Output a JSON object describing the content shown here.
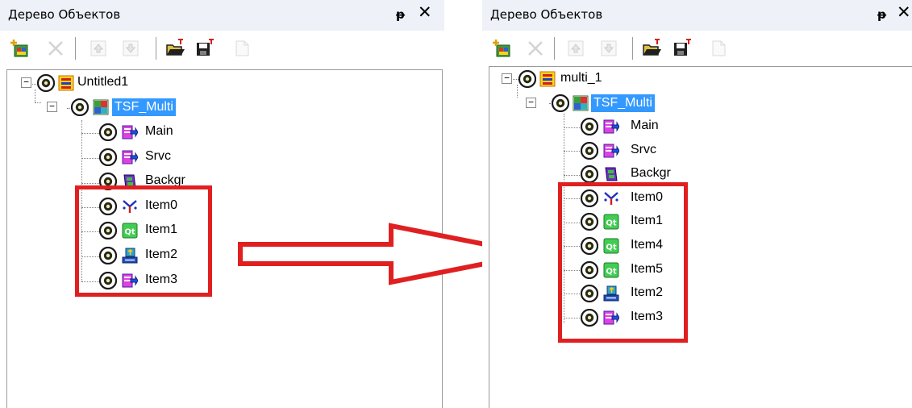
{
  "left": {
    "title": "Дерево Объектов",
    "pin": "ᵽ",
    "close": "✕",
    "root": {
      "label": "Untitled1"
    },
    "module": {
      "label": "TSF_Multi"
    },
    "items": [
      {
        "label": "Main",
        "icon": "script-arrow-icon"
      },
      {
        "label": "Srvc",
        "icon": "script-arrow-icon"
      },
      {
        "label": "Backgr",
        "icon": "film-icon"
      },
      {
        "label": "Item0",
        "icon": "cross-arrows-icon"
      },
      {
        "label": "Item1",
        "icon": "qt-icon"
      },
      {
        "label": "Item2",
        "icon": "transfer-icon"
      },
      {
        "label": "Item3",
        "icon": "script-arrow-icon"
      }
    ]
  },
  "right": {
    "title": "Дерево Объектов",
    "pin": "ᵽ",
    "close": "✕",
    "root": {
      "label": "multi_1"
    },
    "module": {
      "label": "TSF_Multi"
    },
    "items": [
      {
        "label": "Main",
        "icon": "script-arrow-icon"
      },
      {
        "label": "Srvc",
        "icon": "script-arrow-icon"
      },
      {
        "label": "Backgr",
        "icon": "film-icon"
      },
      {
        "label": "Item0",
        "icon": "cross-arrows-icon"
      },
      {
        "label": "Item1",
        "icon": "qt-icon"
      },
      {
        "label": "Item4",
        "icon": "qt-icon"
      },
      {
        "label": "Item5",
        "icon": "qt-icon"
      },
      {
        "label": "Item2",
        "icon": "transfer-icon"
      },
      {
        "label": "Item3",
        "icon": "script-arrow-icon"
      }
    ]
  },
  "colors": {
    "highlight": "#e02020",
    "selection": "#3399ff",
    "titlebar": "#eef1f8"
  }
}
